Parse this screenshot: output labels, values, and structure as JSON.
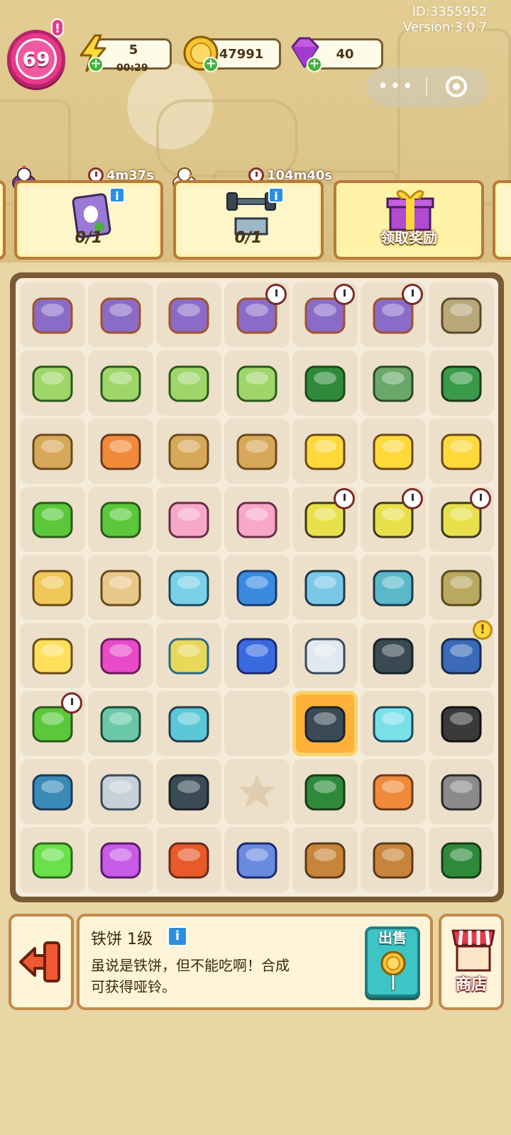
{
  "meta": {
    "id": "ID:3355952",
    "version": "Version:3.0.7"
  },
  "player": {
    "level": "69",
    "alert": "!"
  },
  "resources": {
    "energy": {
      "value": "5",
      "timer": "00:29"
    },
    "coins": {
      "value": "47991"
    },
    "gems": {
      "value": "40"
    }
  },
  "tasks": [
    {
      "timer": "4m37s",
      "progress": "0/1",
      "info": "i"
    },
    {
      "timer": "104m40s",
      "progress": "0/1",
      "info": "i"
    }
  ],
  "reward": {
    "label": "领取奖励"
  },
  "board": {
    "columns": 7,
    "rows": 9,
    "cells": [
      [
        "supply-pile",
        "supply-pile",
        "supply-pile",
        "supply-pile-locked",
        "supply-pile-locked",
        "supply-pile-locked",
        "locker"
      ],
      [
        "laptop",
        "laptop",
        "laptop",
        "laptop",
        "toolbox",
        "supply-crate",
        "equipment-case"
      ],
      [
        "flower-basket",
        "flower-basket-bow",
        "basket",
        "flower-basket",
        "duck-cart",
        "duck-cart",
        "goods-cart"
      ],
      [
        "potted-tree",
        "potted-tree",
        "fridge-cat",
        "fridge",
        "dumbbell-cart-locked",
        "dumbbell-cart-locked",
        "dumbbell-cart-locked"
      ],
      [
        "sprout-pot",
        "soil-pot",
        "treadmill-machine",
        "round-machine",
        "weight-bench",
        "leg-bench",
        "yoga-mats"
      ],
      [
        "chick",
        "infinity-token",
        "jump-rope",
        "music-player",
        "dumbbell-pair",
        "kettlebell",
        "gym-backpack"
      ],
      [
        "potted-tree-locked",
        "battery-case",
        "hand-grip",
        "empty",
        "iron-plate",
        "water-dumbbell",
        "wheels"
      ],
      [
        "puzzle-mat",
        "spring-expander",
        "ab-wheel",
        "star-slot",
        "push-up-bar",
        "energy-drink",
        "caster-wheel"
      ],
      [
        "green-energy-orb",
        "purple-energy-orb",
        "coin-bag",
        "gift-box",
        "bread",
        "cup",
        "green-bag"
      ]
    ],
    "selected": "iron-plate"
  },
  "selected_item": {
    "name": "铁饼 1级",
    "info": "i",
    "desc_line1": "虽说是铁饼，但不能吃啊！合成",
    "desc_line2": "可获得哑铃。",
    "sell_label": "出售"
  },
  "shop": {
    "label": "商店"
  },
  "colors": {
    "accent_pink": "#e8398b",
    "panel_border": "#c28a4c",
    "board_frame": "#7a5a34",
    "sell_teal": "#3ec4c4"
  }
}
